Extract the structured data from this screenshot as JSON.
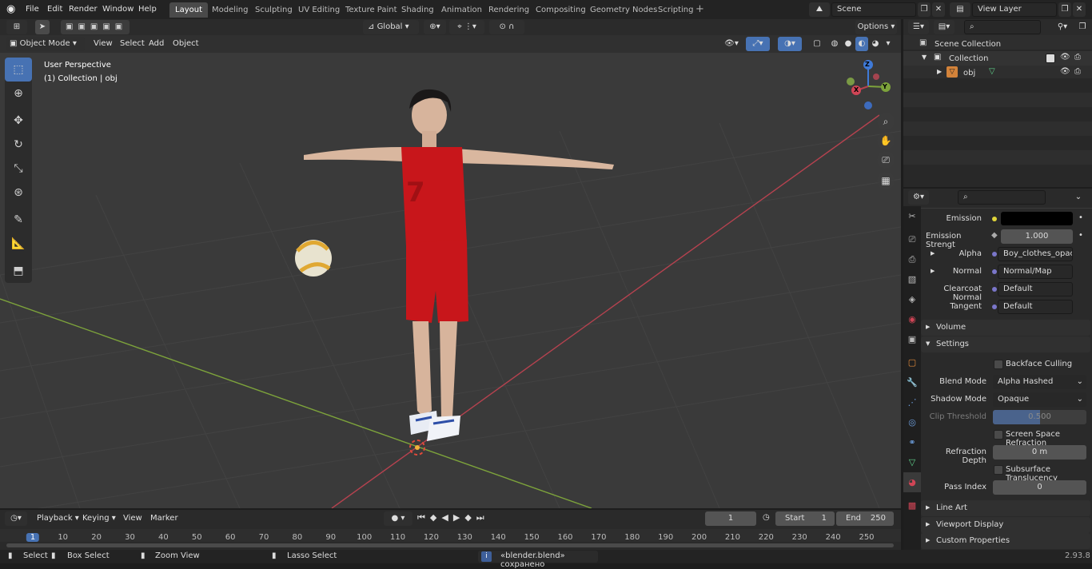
{
  "topbar": {
    "menus": [
      "File",
      "Edit",
      "Render",
      "Window",
      "Help"
    ],
    "workspaces": [
      "Layout",
      "Modeling",
      "Sculpting",
      "UV Editing",
      "Texture Paint",
      "Shading",
      "Animation",
      "Rendering",
      "Compositing",
      "Geometry Nodes",
      "Scripting"
    ],
    "active_workspace": "Layout",
    "scene": "Scene",
    "view_layer": "View Layer"
  },
  "tool_header": {
    "transform_orientation": "Global",
    "options_label": "Options"
  },
  "viewport_header": {
    "mode": "Object Mode",
    "menus": [
      "View",
      "Select",
      "Add",
      "Object"
    ]
  },
  "viewport": {
    "perspective": "User Perspective",
    "collection_info": "(1) Collection | obj",
    "gizmo_axes": [
      "Z",
      "Y",
      "X"
    ]
  },
  "outliner": {
    "scene_collection": "Scene Collection",
    "collection": "Collection",
    "object": "obj"
  },
  "properties": {
    "rows": [
      {
        "label": "Emission",
        "value": ""
      },
      {
        "label": "Emission Strengt",
        "value": "1.000"
      },
      {
        "label": "Alpha",
        "value": "Boy_clothes_opacity..."
      },
      {
        "label": "Normal",
        "value": "Normal/Map"
      },
      {
        "label": "Clearcoat Normal",
        "value": "Default"
      },
      {
        "label": "Tangent",
        "value": "Default"
      }
    ],
    "sections": {
      "volume": "Volume",
      "settings": "Settings",
      "line_art": "Line Art",
      "viewport_display": "Viewport Display",
      "custom_properties": "Custom Properties"
    },
    "backface_culling": "Backface Culling",
    "blend_mode_label": "Blend Mode",
    "blend_mode": "Alpha Hashed",
    "shadow_mode_label": "Shadow Mode",
    "shadow_mode": "Opaque",
    "clip_threshold_label": "Clip Threshold",
    "clip_threshold": "0.500",
    "clip_threshold_fraction": 0.5,
    "ssr_label": "Screen Space Refraction",
    "refraction_depth_label": "Refraction Depth",
    "refraction_depth": "0 m",
    "sss_label": "Subsurface Translucency",
    "pass_index_label": "Pass Index",
    "pass_index": "0"
  },
  "timeline": {
    "menus": [
      "Playback",
      "Keying",
      "View",
      "Marker"
    ],
    "current_frame": "1",
    "start_label": "Start",
    "start": "1",
    "end_label": "End",
    "end": "250",
    "ticks": [
      "1",
      "10",
      "20",
      "30",
      "40",
      "50",
      "60",
      "70",
      "80",
      "90",
      "100",
      "110",
      "120",
      "130",
      "140",
      "150",
      "160",
      "170",
      "180",
      "190",
      "200",
      "210",
      "220",
      "230",
      "240",
      "250"
    ]
  },
  "statusbar": {
    "select": "Select",
    "box_select": "Box Select",
    "zoom_view": "Zoom View",
    "lasso_select": "Lasso Select",
    "message": "«blender.blend» сохранено",
    "version": "2.93.8"
  },
  "colors": {
    "accent": "#4772b3",
    "x_axis": "#b5424f",
    "y_axis": "#7da33b",
    "z_axis": "#3f7ad8",
    "jersey": "#c8161b"
  }
}
